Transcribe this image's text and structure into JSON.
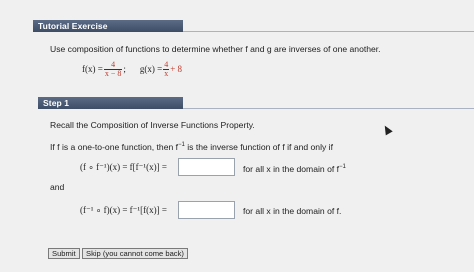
{
  "tutorial": {
    "title": "Tutorial Exercise",
    "instruction": "Use composition of functions to determine whether f and g are inverses of one another.",
    "f_lhs": "f(x) =",
    "f_num": "4",
    "f_den": "x − 8",
    "separator": ";",
    "g_lhs": "g(x) =",
    "g_num": "4",
    "g_den": "x",
    "g_tail": "+ 8"
  },
  "step": {
    "title": "Step 1",
    "recall": "Recall the Composition of Inverse Functions Property.",
    "condition_pre": "If f is a one-to-one function, then f",
    "condition_sup": "−1",
    "condition_post": "is the inverse function of f if and only if",
    "eq1_lhs": "(f ∘ f⁻¹)(x) = f[f⁻¹(x)] =",
    "eq1_tail_pre": "for all x in the domain of f",
    "eq1_tail_sup": "−1",
    "and_label": "and",
    "eq2_lhs": "(f⁻¹ ∘ f)(x) = f⁻¹[f(x)] =",
    "eq2_tail": "for all x in the domain of f."
  },
  "buttons": {
    "submit": "Submit",
    "skip": "Skip (you cannot come back)"
  },
  "inputs": {
    "eq1_value": "",
    "eq2_value": ""
  }
}
